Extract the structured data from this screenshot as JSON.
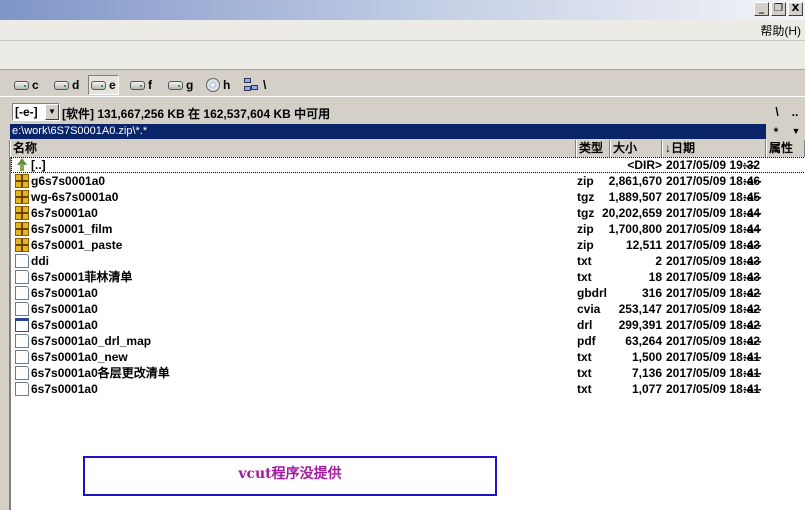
{
  "window": {
    "min": "_",
    "restore": "❐",
    "close": "X"
  },
  "menu": {
    "help": "帮助(H)"
  },
  "drives": [
    {
      "letter": "c",
      "icon": "hard-drive-icon"
    },
    {
      "letter": "d",
      "icon": "hard-drive-icon"
    },
    {
      "letter": "e",
      "icon": "hard-drive-icon",
      "active": true
    },
    {
      "letter": "f",
      "icon": "hard-drive-icon"
    },
    {
      "letter": "g",
      "icon": "hard-drive-icon"
    },
    {
      "letter": "h",
      "icon": "cd-drive-icon"
    },
    {
      "letter": "\\",
      "icon": "network-icon"
    }
  ],
  "pathbar": {
    "drive_select": "[-e-]",
    "disk_info": "[软件]  131,667,256 KB 在 162,537,604 KB 中可用",
    "root_btn": "\\",
    "up_btn": "..",
    "current_path": "e:\\work\\6S7S0001A0.zip\\*.*",
    "star_btn": "*",
    "hist_btn": "▼"
  },
  "columns": {
    "name": "名称",
    "type": "类型",
    "size": "大小",
    "date": "↓日期",
    "attr": "属性"
  },
  "files": [
    {
      "name": "[..]",
      "type": "",
      "size": "<DIR>",
      "date": "2017/05/09 19:32",
      "attr": "—",
      "icon": "up"
    },
    {
      "name": "g6s7s0001a0",
      "type": "zip",
      "size": "2,861,670",
      "date": "2017/05/09 18:46",
      "attr": "-a--",
      "icon": "zip"
    },
    {
      "name": "wg-6s7s0001a0",
      "type": "tgz",
      "size": "1,889,507",
      "date": "2017/05/09 18:45",
      "attr": "-a--",
      "icon": "zip"
    },
    {
      "name": "6s7s0001a0",
      "type": "tgz",
      "size": "20,202,659",
      "date": "2017/05/09 18:44",
      "attr": "-a--",
      "icon": "zip"
    },
    {
      "name": "6s7s0001_film",
      "type": "zip",
      "size": "1,700,800",
      "date": "2017/05/09 18:44",
      "attr": "-a--",
      "icon": "zip"
    },
    {
      "name": "6s7s0001_paste",
      "type": "zip",
      "size": "12,511",
      "date": "2017/05/09 18:43",
      "attr": "-a--",
      "icon": "zip"
    },
    {
      "name": "ddi",
      "type": "txt",
      "size": "2",
      "date": "2017/05/09 18:43",
      "attr": "-a--",
      "icon": "txt"
    },
    {
      "name": "6s7s0001菲林清单",
      "type": "txt",
      "size": "18",
      "date": "2017/05/09 18:43",
      "attr": "-a--",
      "icon": "txt"
    },
    {
      "name": "6s7s0001a0",
      "type": "gbdrl",
      "size": "316",
      "date": "2017/05/09 18:42",
      "attr": "-a--",
      "icon": "txt"
    },
    {
      "name": "6s7s0001a0",
      "type": "cvia",
      "size": "253,147",
      "date": "2017/05/09 18:42",
      "attr": "-a--",
      "icon": "txt"
    },
    {
      "name": "6s7s0001a0",
      "type": "drl",
      "size": "299,391",
      "date": "2017/05/09 18:42",
      "attr": "-a--",
      "icon": "app"
    },
    {
      "name": "6s7s0001a0_drl_map",
      "type": "pdf",
      "size": "63,264",
      "date": "2017/05/09 18:42",
      "attr": "-a--",
      "icon": "txt"
    },
    {
      "name": "6s7s0001a0_new",
      "type": "txt",
      "size": "1,500",
      "date": "2017/05/09 18:41",
      "attr": "-a--",
      "icon": "txt"
    },
    {
      "name": "6s7s0001a0各层更改清单",
      "type": "txt",
      "size": "7,136",
      "date": "2017/05/09 18:41",
      "attr": "-a--",
      "icon": "txt"
    },
    {
      "name": "6s7s0001a0",
      "type": "txt",
      "size": "1,077",
      "date": "2017/05/09 18:41",
      "attr": "-a--",
      "icon": "txt"
    }
  ],
  "annotation": "vcut程序没提供"
}
